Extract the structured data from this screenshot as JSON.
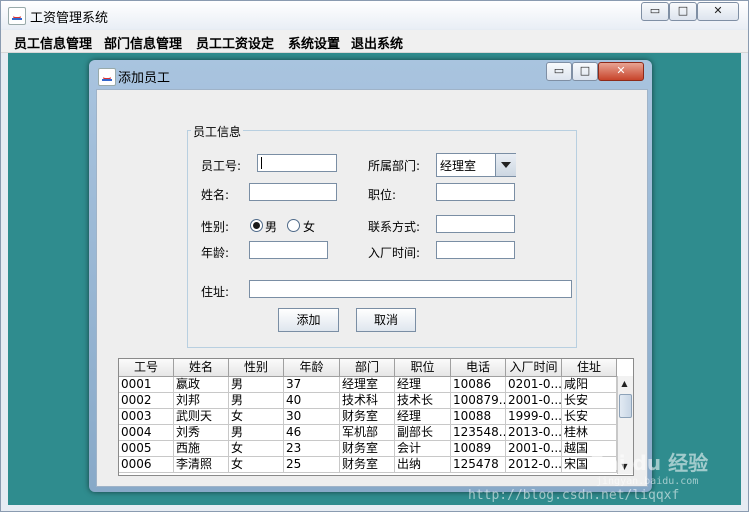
{
  "app": {
    "title": "工资管理系统",
    "window_controls": {
      "minimize": "▭",
      "maximize": "□",
      "close": "✕"
    }
  },
  "menu": [
    "员工信息管理",
    "部门信息管理",
    "员工工资设定",
    "系统设置",
    "退出系统"
  ],
  "dialog": {
    "title": "添加员工",
    "group_title": "员工信息",
    "labels": {
      "emp_no": "员工号:",
      "dept": "所属部门:",
      "name": "姓名:",
      "position": "职位:",
      "gender": "性别:",
      "contact": "联系方式:",
      "age": "年龄:",
      "hire_date": "入厂时间:",
      "address": "住址:"
    },
    "gender_options": [
      "男",
      "女"
    ],
    "gender_selected": "男",
    "dept_selected": "经理室",
    "buttons": {
      "add": "添加",
      "cancel": "取消"
    }
  },
  "table": {
    "columns": [
      "工号",
      "姓名",
      "性别",
      "年龄",
      "部门",
      "职位",
      "电话",
      "入厂时间",
      "住址"
    ],
    "rows": [
      [
        "0001",
        "嬴政",
        "男",
        "37",
        "经理室",
        "经理",
        "10086",
        "0201-0...",
        "咸阳"
      ],
      [
        "0002",
        "刘邦",
        "男",
        "40",
        "技术科",
        "技术长",
        "100879...",
        "2001-0...",
        "长安"
      ],
      [
        "0003",
        "武则天",
        "女",
        "30",
        "财务室",
        "经理",
        "10088",
        "1999-0...",
        "长安"
      ],
      [
        "0004",
        "刘秀",
        "男",
        "46",
        "军机部",
        "副部长",
        "123548...",
        "2013-0...",
        "桂林"
      ],
      [
        "0005",
        "西施",
        "女",
        "23",
        "财务室",
        "会计",
        "10089",
        "2001-0...",
        "越国"
      ],
      [
        "0006",
        "李清照",
        "女",
        "25",
        "财务室",
        "出纳",
        "125478",
        "2012-0...",
        "宋国"
      ]
    ]
  },
  "watermark": {
    "brand": "Bai du 经验",
    "url": "jingyan.baidu.com",
    "blog": "http://blog.csdn.net/liqqxf"
  }
}
